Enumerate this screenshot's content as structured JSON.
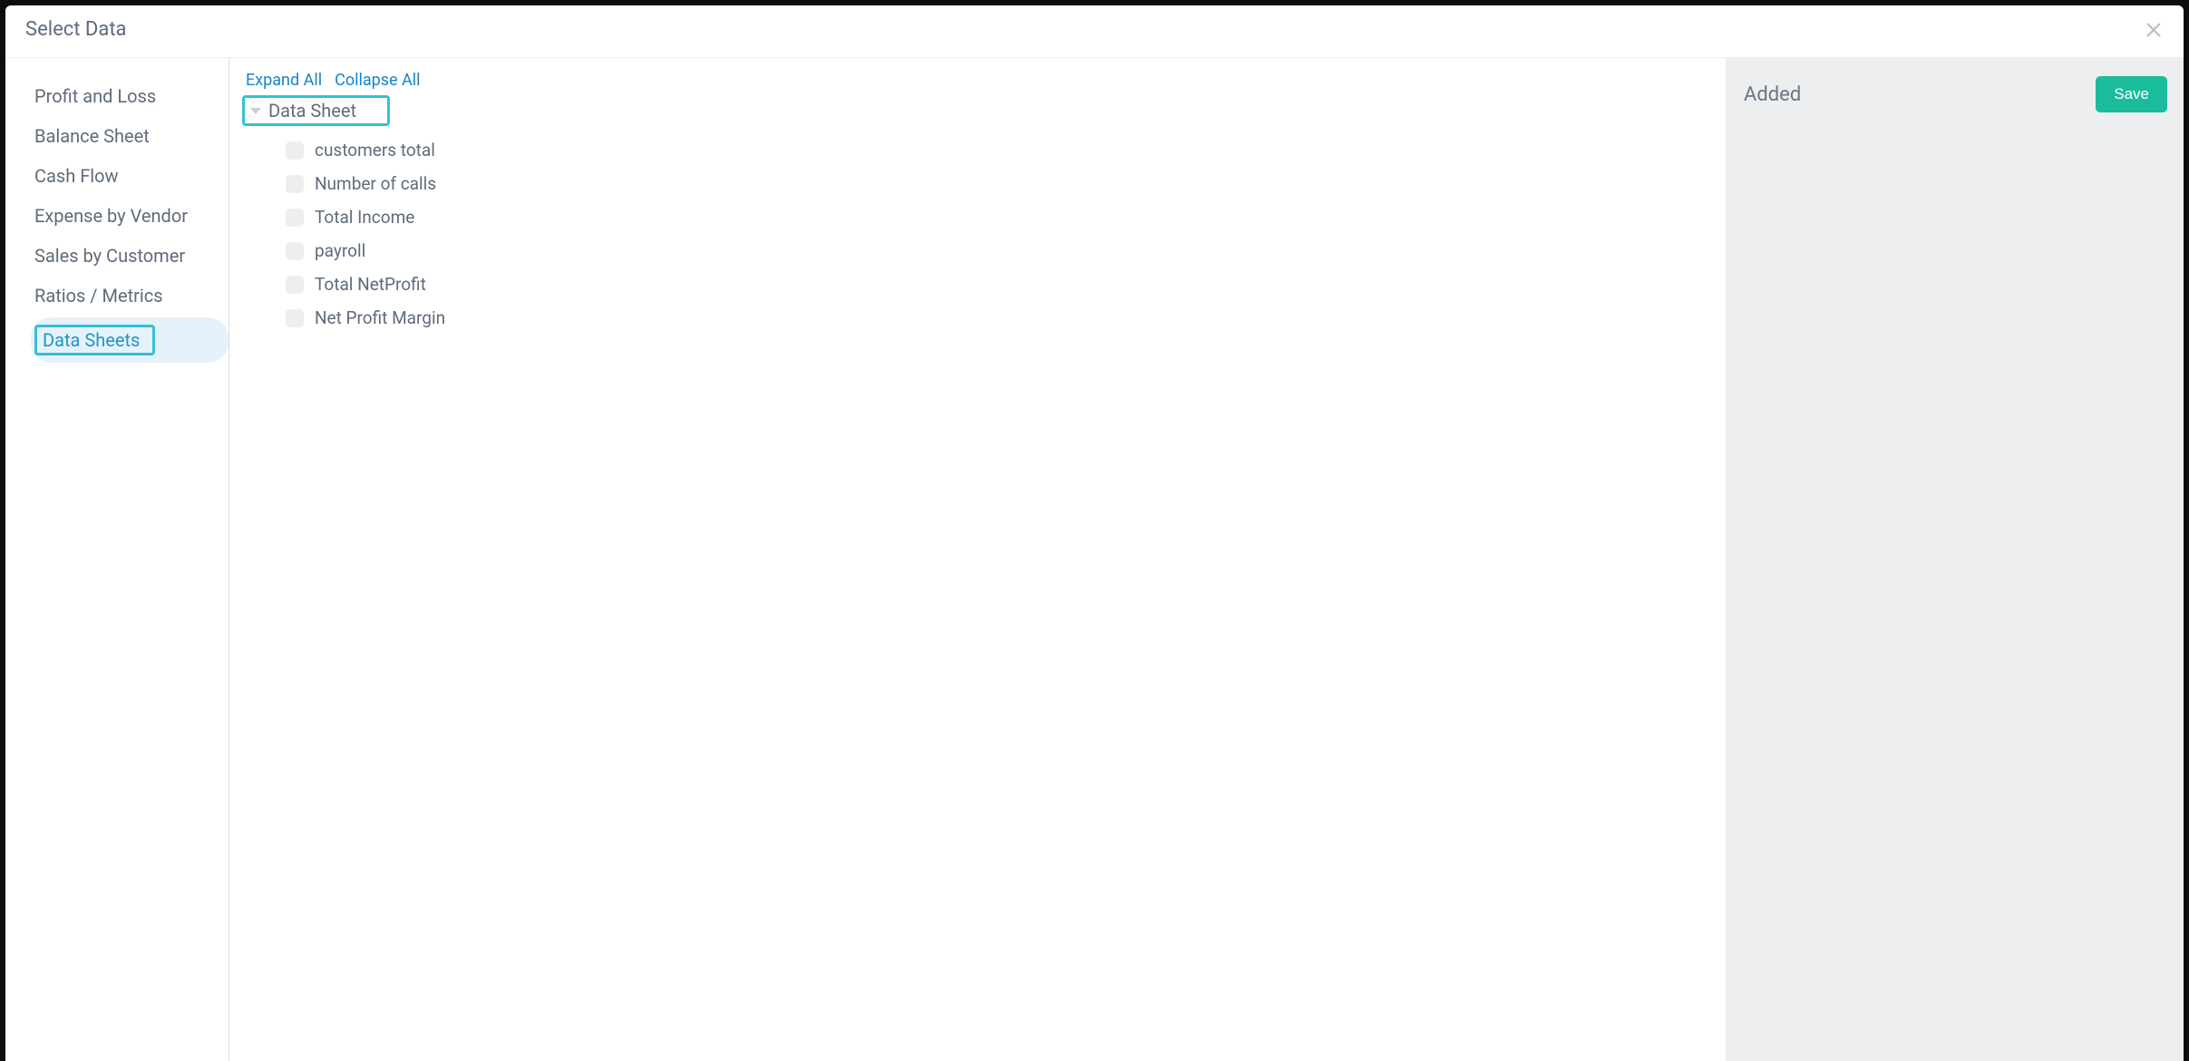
{
  "modal": {
    "title": "Select Data",
    "close_icon": "close"
  },
  "sidebar": {
    "items": [
      {
        "label": "Profit and Loss",
        "active": false
      },
      {
        "label": "Balance Sheet",
        "active": false
      },
      {
        "label": "Cash Flow",
        "active": false
      },
      {
        "label": "Expense by Vendor",
        "active": false
      },
      {
        "label": "Sales by Customer",
        "active": false
      },
      {
        "label": "Ratios / Metrics",
        "active": false
      },
      {
        "label": "Data Sheets",
        "active": true
      }
    ]
  },
  "tree": {
    "expand_all": "Expand All",
    "collapse_all": "Collapse All",
    "group": {
      "title": "Data Sheet",
      "expanded": true,
      "items": [
        {
          "label": "customers total"
        },
        {
          "label": "Number of calls"
        },
        {
          "label": "Total Income"
        },
        {
          "label": "payroll"
        },
        {
          "label": "Total NetProfit"
        },
        {
          "label": "Net Profit Margin"
        }
      ]
    }
  },
  "added": {
    "title": "Added",
    "save_label": "Save"
  },
  "colors": {
    "accent": "#33c0d6",
    "link": "#1486c6",
    "save": "#1abc9c",
    "panel": "#eceef0"
  }
}
